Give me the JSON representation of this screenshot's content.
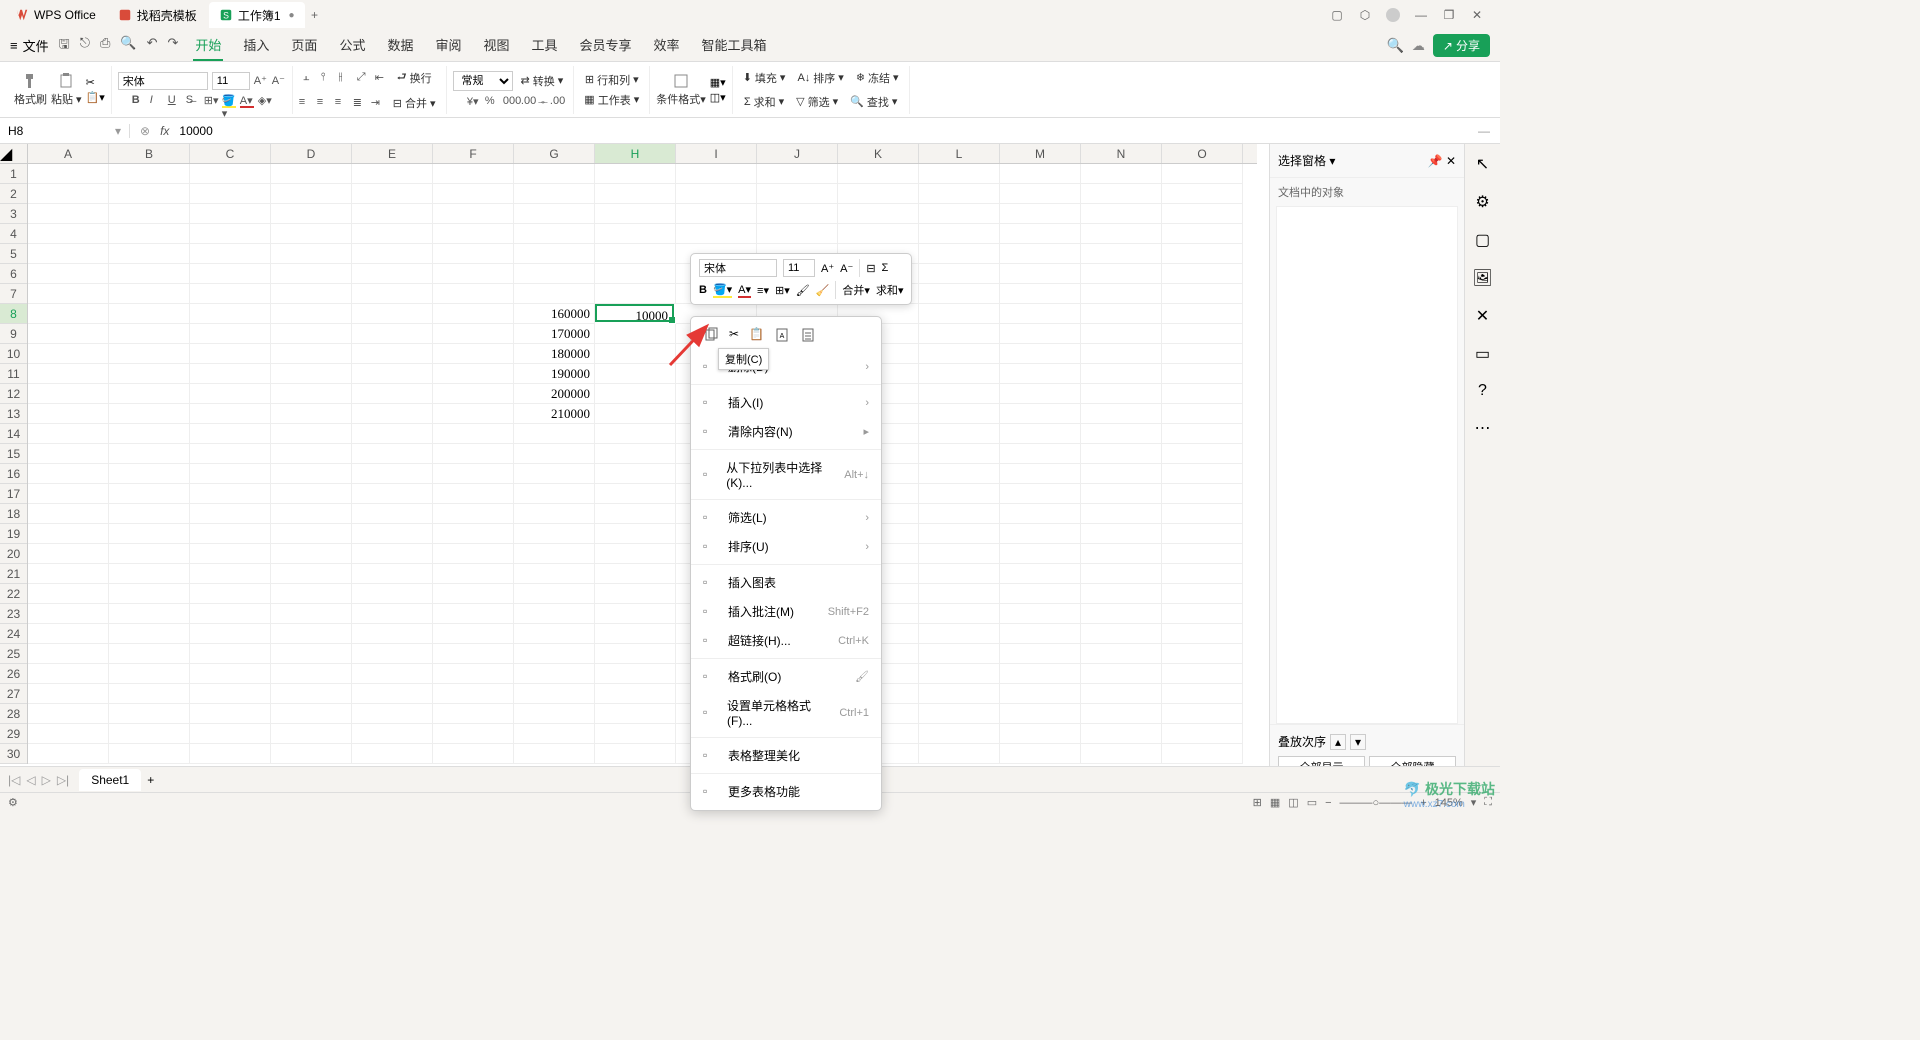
{
  "titlebar": {
    "tabs": [
      {
        "label": "WPS Office",
        "icon_color": "#d94b3a"
      },
      {
        "label": "找稻壳模板",
        "icon_color": "#d94b3a"
      },
      {
        "label": "工作簿1",
        "icon_color": "#18a058",
        "active": true
      }
    ]
  },
  "menubar": {
    "file": "文件",
    "tabs": [
      "开始",
      "插入",
      "页面",
      "公式",
      "数据",
      "审阅",
      "视图",
      "工具",
      "会员专享",
      "效率",
      "智能工具箱"
    ],
    "active_tab": "开始",
    "share": "分享"
  },
  "ribbon": {
    "format_brush": "格式刷",
    "paste": "粘贴",
    "font_name": "宋体",
    "font_size": "11",
    "wrap": "换行",
    "merge": "合并",
    "general": "常规",
    "convert": "转换",
    "rowcol": "行和列",
    "worksheet": "工作表",
    "cond_format": "条件格式",
    "fill": "填充",
    "sort": "排序",
    "freeze": "冻结",
    "sum": "求和",
    "filter": "筛选",
    "find": "查找"
  },
  "formula_bar": {
    "cell_ref": "H8",
    "formula": "10000"
  },
  "columns": [
    "A",
    "B",
    "C",
    "D",
    "E",
    "F",
    "G",
    "H",
    "I",
    "J",
    "K",
    "L",
    "M",
    "N",
    "O"
  ],
  "active_col_index": 7,
  "active_row": 8,
  "row_count": 30,
  "cells_data": {
    "G8": "160000",
    "G9": "170000",
    "G10": "180000",
    "G11": "190000",
    "G12": "200000",
    "G13": "210000",
    "H8": "10000"
  },
  "mini_toolbar": {
    "font_name": "宋体",
    "font_size": "11",
    "merge": "合并",
    "sum": "求和"
  },
  "context_menu": {
    "copy_tooltip": "复制(C)",
    "items": [
      {
        "label": "删除(D)",
        "has_sub": true
      },
      {
        "label": "插入(I)",
        "has_sub": true
      },
      {
        "label": "清除内容(N)",
        "has_sub": true,
        "sub_boxed": true
      },
      {
        "label": "从下拉列表中选择(K)...",
        "shortcut": "Alt+↓"
      },
      {
        "label": "筛选(L)",
        "has_sub": true
      },
      {
        "label": "排序(U)",
        "has_sub": true
      },
      {
        "label": "插入图表"
      },
      {
        "label": "插入批注(M)",
        "shortcut": "Shift+F2"
      },
      {
        "label": "超链接(H)...",
        "shortcut": "Ctrl+K"
      },
      {
        "label": "格式刷(O)",
        "has_right_icon": true
      },
      {
        "label": "设置单元格格式(F)...",
        "shortcut": "Ctrl+1"
      },
      {
        "label": "表格整理美化"
      },
      {
        "label": "更多表格功能"
      }
    ]
  },
  "right_panel": {
    "title": "选择窗格",
    "subtitle": "文档中的对象",
    "stack_order": "叠放次序",
    "show_all": "全部显示",
    "hide_all": "全部隐藏"
  },
  "sheet_tabs": {
    "active": "Sheet1"
  },
  "status_bar": {
    "zoom": "145%"
  },
  "watermark": {
    "logo": "极光下载站",
    "url": "www.xz7.com"
  }
}
